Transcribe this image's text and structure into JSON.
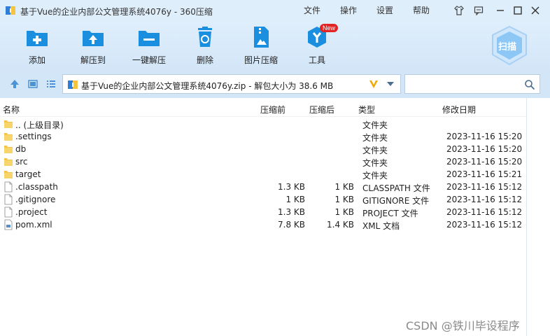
{
  "window": {
    "title": "基于Vue的企业内部公文管理系统4076y - 360压缩",
    "menu": [
      "文件",
      "操作",
      "设置",
      "帮助"
    ]
  },
  "toolbar": {
    "items": [
      {
        "label": "添加",
        "icon": "add-icon"
      },
      {
        "label": "解压到",
        "icon": "extract-to-icon"
      },
      {
        "label": "一键解压",
        "icon": "one-click-extract-icon"
      },
      {
        "label": "删除",
        "icon": "trash-icon"
      },
      {
        "label": "图片压缩",
        "icon": "image-compress-icon"
      },
      {
        "label": "工具",
        "icon": "tools-icon"
      }
    ],
    "new_badge": "New",
    "scan_label": "扫描"
  },
  "address": {
    "path": "基于Vue的企业内部公文管理系统4076y.zip - 解包大小为 38.6 MB"
  },
  "columns": {
    "name": "名称",
    "compressed": "压缩前",
    "original": "压缩后",
    "type": "类型",
    "modified": "修改日期"
  },
  "files": [
    {
      "name": ".. (上级目录)",
      "compressed": "",
      "original": "",
      "type": "文件夹",
      "modified": "",
      "kind": "folder"
    },
    {
      "name": ".settings",
      "compressed": "",
      "original": "",
      "type": "文件夹",
      "modified": "2023-11-16 15:20",
      "kind": "folder"
    },
    {
      "name": "db",
      "compressed": "",
      "original": "",
      "type": "文件夹",
      "modified": "2023-11-16 15:20",
      "kind": "folder"
    },
    {
      "name": "src",
      "compressed": "",
      "original": "",
      "type": "文件夹",
      "modified": "2023-11-16 15:20",
      "kind": "folder"
    },
    {
      "name": "target",
      "compressed": "",
      "original": "",
      "type": "文件夹",
      "modified": "2023-11-16 15:21",
      "kind": "folder"
    },
    {
      "name": ".classpath",
      "compressed": "1.3 KB",
      "original": "1 KB",
      "type": "CLASSPATH 文件",
      "modified": "2023-11-16 15:12",
      "kind": "file"
    },
    {
      "name": ".gitignore",
      "compressed": "1 KB",
      "original": "1 KB",
      "type": "GITIGNORE 文件",
      "modified": "2023-11-16 15:12",
      "kind": "file"
    },
    {
      "name": ".project",
      "compressed": "1.3 KB",
      "original": "1 KB",
      "type": "PROJECT 文件",
      "modified": "2023-11-16 15:12",
      "kind": "file"
    },
    {
      "name": "pom.xml",
      "compressed": "7.8 KB",
      "original": "1.4 KB",
      "type": "XML 文档",
      "modified": "2023-11-16 15:12",
      "kind": "xml"
    }
  ],
  "watermark": "CSDN @铁川毕设程序",
  "colors": {
    "titlebar": "#dfeefb",
    "toolbar_icon": "#1a8fe0",
    "folder": "#f5c542",
    "badge": "#e32424",
    "accent_v": "#f0a800"
  }
}
